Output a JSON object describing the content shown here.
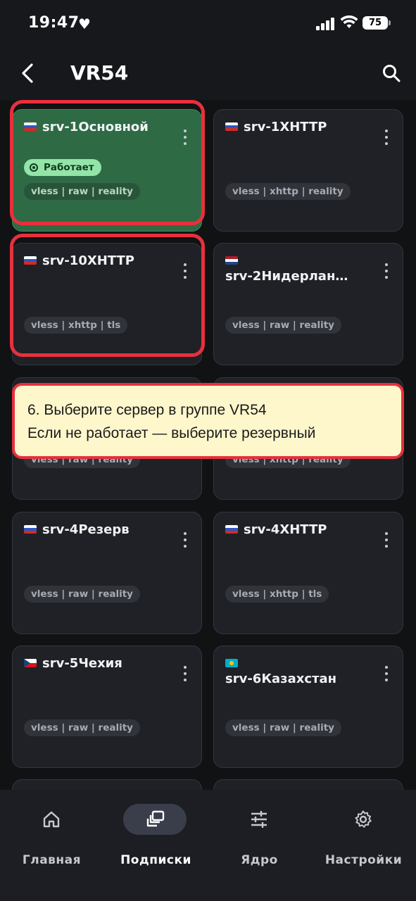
{
  "status_bar": {
    "time": "19:47",
    "battery": "75"
  },
  "header": {
    "title": "VR54"
  },
  "servers": [
    {
      "name": "srv-1Основной",
      "flag": "ru",
      "tag": "vless | raw | reality",
      "status": "Работает",
      "active": true
    },
    {
      "name": "srv-1XHTTP",
      "flag": "ru",
      "tag": "vless | xhttp | reality"
    },
    {
      "name": "srv-10XHTTP",
      "flag": "ru",
      "tag": "vless | xhttp | tls"
    },
    {
      "name": "srv-2Нидерлан…",
      "flag": "nl",
      "tag": "vless | raw | reality"
    },
    {
      "tag": "vless | raw | reality"
    },
    {
      "tag": "vless | xhttp | reality"
    },
    {
      "name": "srv-4Резерв",
      "flag": "ru",
      "tag": "vless | raw | reality"
    },
    {
      "name": "srv-4XHTTP",
      "flag": "ru",
      "tag": "vless | xhttp | tls"
    },
    {
      "name": "srv-5Чехия",
      "flag": "cz",
      "tag": "vless | raw | reality"
    },
    {
      "name": "srv-6Казахстан",
      "flag": "kz",
      "tag": "vless | raw | reality"
    }
  ],
  "tooltip": {
    "line1": "6. Выберите сервер в группе VR54",
    "line2": "Если не работает — выберите резервный"
  },
  "nav": [
    {
      "label": "Главная",
      "icon": "home-icon"
    },
    {
      "label": "Подписки",
      "icon": "subscriptions-icon",
      "active": true
    },
    {
      "label": "Ядро",
      "icon": "sliders-icon"
    },
    {
      "label": "Настройки",
      "icon": "gear-icon"
    }
  ],
  "colors": {
    "active_card": "#2e6b44",
    "highlight": "#e8303c",
    "tooltip_bg": "#fff7cc",
    "status_pill": "#93e4a8"
  }
}
